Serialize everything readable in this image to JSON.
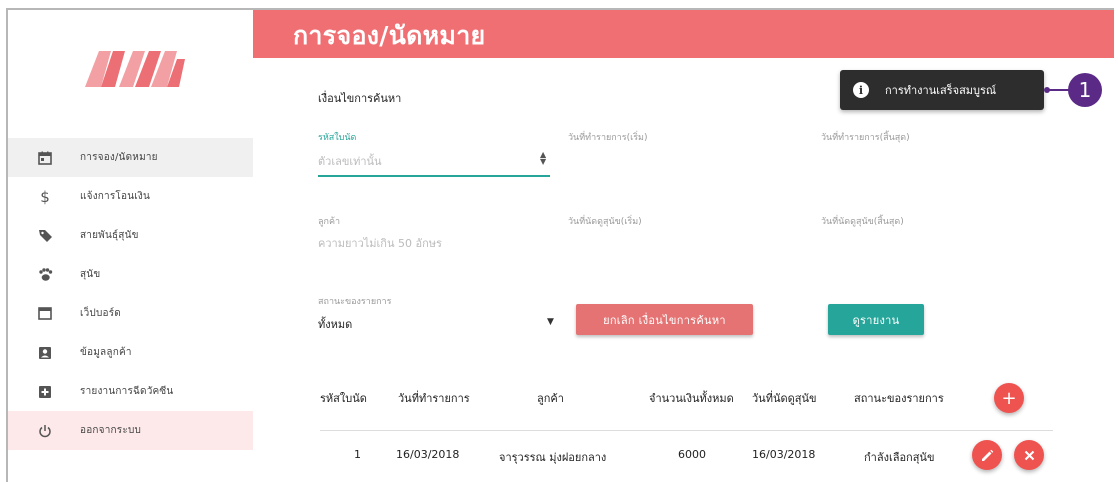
{
  "header": {
    "title": "การจอง/นัดหมาย"
  },
  "sidebar": {
    "items": [
      {
        "icon": "calendar-icon",
        "label": "การจอง/นัดหมาย",
        "active": true
      },
      {
        "icon": "dollar-icon",
        "label": "แจ้งการโอนเงิน"
      },
      {
        "icon": "tag-icon",
        "label": "สายพันธุ์สุนัข"
      },
      {
        "icon": "paw-icon",
        "label": "สุนัข"
      },
      {
        "icon": "webboard-icon",
        "label": "เว็ปบอร์ด"
      },
      {
        "icon": "account-box-icon",
        "label": "ข้อมูลลูกค้า"
      },
      {
        "icon": "medical-plus-icon",
        "label": "รายงานการฉีดวัคซีน"
      },
      {
        "icon": "power-icon",
        "label": "ออกจากระบบ"
      }
    ]
  },
  "search": {
    "title": "เงื่อนไขการค้นหา",
    "booking_id_label": "รหัสใบนัด",
    "booking_id_placeholder": "ตัวเลขเท่านั้น",
    "txn_start_label": "วันที่ทำรายการ(เริ่ม)",
    "txn_end_label": "วันที่ทำรายการ(สิ้นสุด)",
    "customer_label": "ลูกค้า",
    "customer_placeholder": "ความยาวไม่เกิน 50 อักษร",
    "appt_start_label": "วันที่นัดดูสุนัข(เริ่ม)",
    "appt_end_label": "วันที่นัดดูสุนัข(สิ้นสุด)",
    "status_label": "สถานะของรายการ",
    "status_value": "ทั้งหมด",
    "cancel_button": "ยกเลิก เงื่อนไขการค้นหา",
    "view_button": "ดูรายงาน"
  },
  "toast": {
    "message": "การทำงานเสร็จสมบูรณ์"
  },
  "callout": {
    "number": "1"
  },
  "table": {
    "headers": [
      "รหัสใบนัด",
      "วันที่ทำรายการ",
      "ลูกค้า",
      "จำนวนเงินทั้งหมด",
      "วันที่นัดดูสุนัข",
      "สถานะของรายการ"
    ],
    "rows": [
      [
        "1",
        "16/03/2018",
        "จารุวรรณ มุ่งฝอยกลาง",
        "6000",
        "16/03/2018",
        "กำลังเลือกสุนัข"
      ]
    ]
  },
  "colors": {
    "brand": "#ef6f73",
    "accent": "#26a69a",
    "danger": "#ef5350",
    "callout": "#5b2a86"
  }
}
